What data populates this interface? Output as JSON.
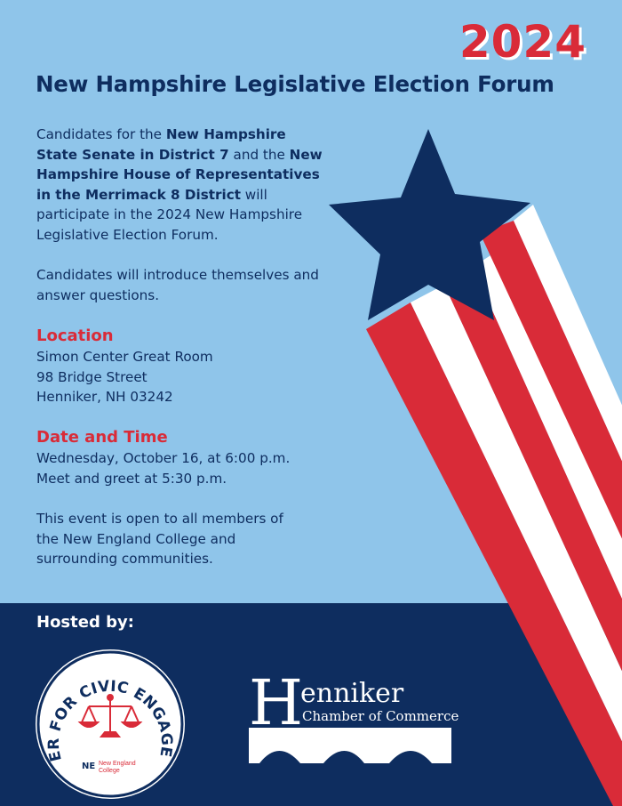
{
  "year": "2024",
  "headline": "New Hampshire Legislative Election Forum",
  "intro": {
    "p1": "Candidates for the ",
    "b1": "New Hampshire State Senate in District 7",
    "p2": " and the ",
    "b2": "New Hampshire House of Representatives in the Merrimack 8 District",
    "p3": " will participate in the 2024 New Hampshire Legislative Election Forum."
  },
  "intro2": "Candidates will introduce themselves and answer questions.",
  "location": {
    "heading": "Location",
    "line1": "Simon Center Great Room",
    "line2": "98 Bridge Street",
    "line3": "Henniker, NH 03242"
  },
  "datetime": {
    "heading": "Date and Time",
    "line1": "Wednesday, October 16, at 6:00 p.m.",
    "line2": "Meet and greet at 5:30 p.m."
  },
  "open_note": "This event is open to all members of the New England College and surrounding communities.",
  "hosted_by": "Hosted by:",
  "seal": {
    "arc_text": "CENTER FOR CIVIC ENGAGEMENT",
    "college_line1": "New England",
    "college_line2": "College",
    "monogram": "NE"
  },
  "chamber": {
    "initial": "H",
    "name_rest": "enniker",
    "subtitle": "Chamber of Commerce"
  },
  "colors": {
    "sky": "#8fc5ea",
    "navy": "#0e2d5f",
    "red": "#d92b38",
    "white": "#ffffff"
  }
}
